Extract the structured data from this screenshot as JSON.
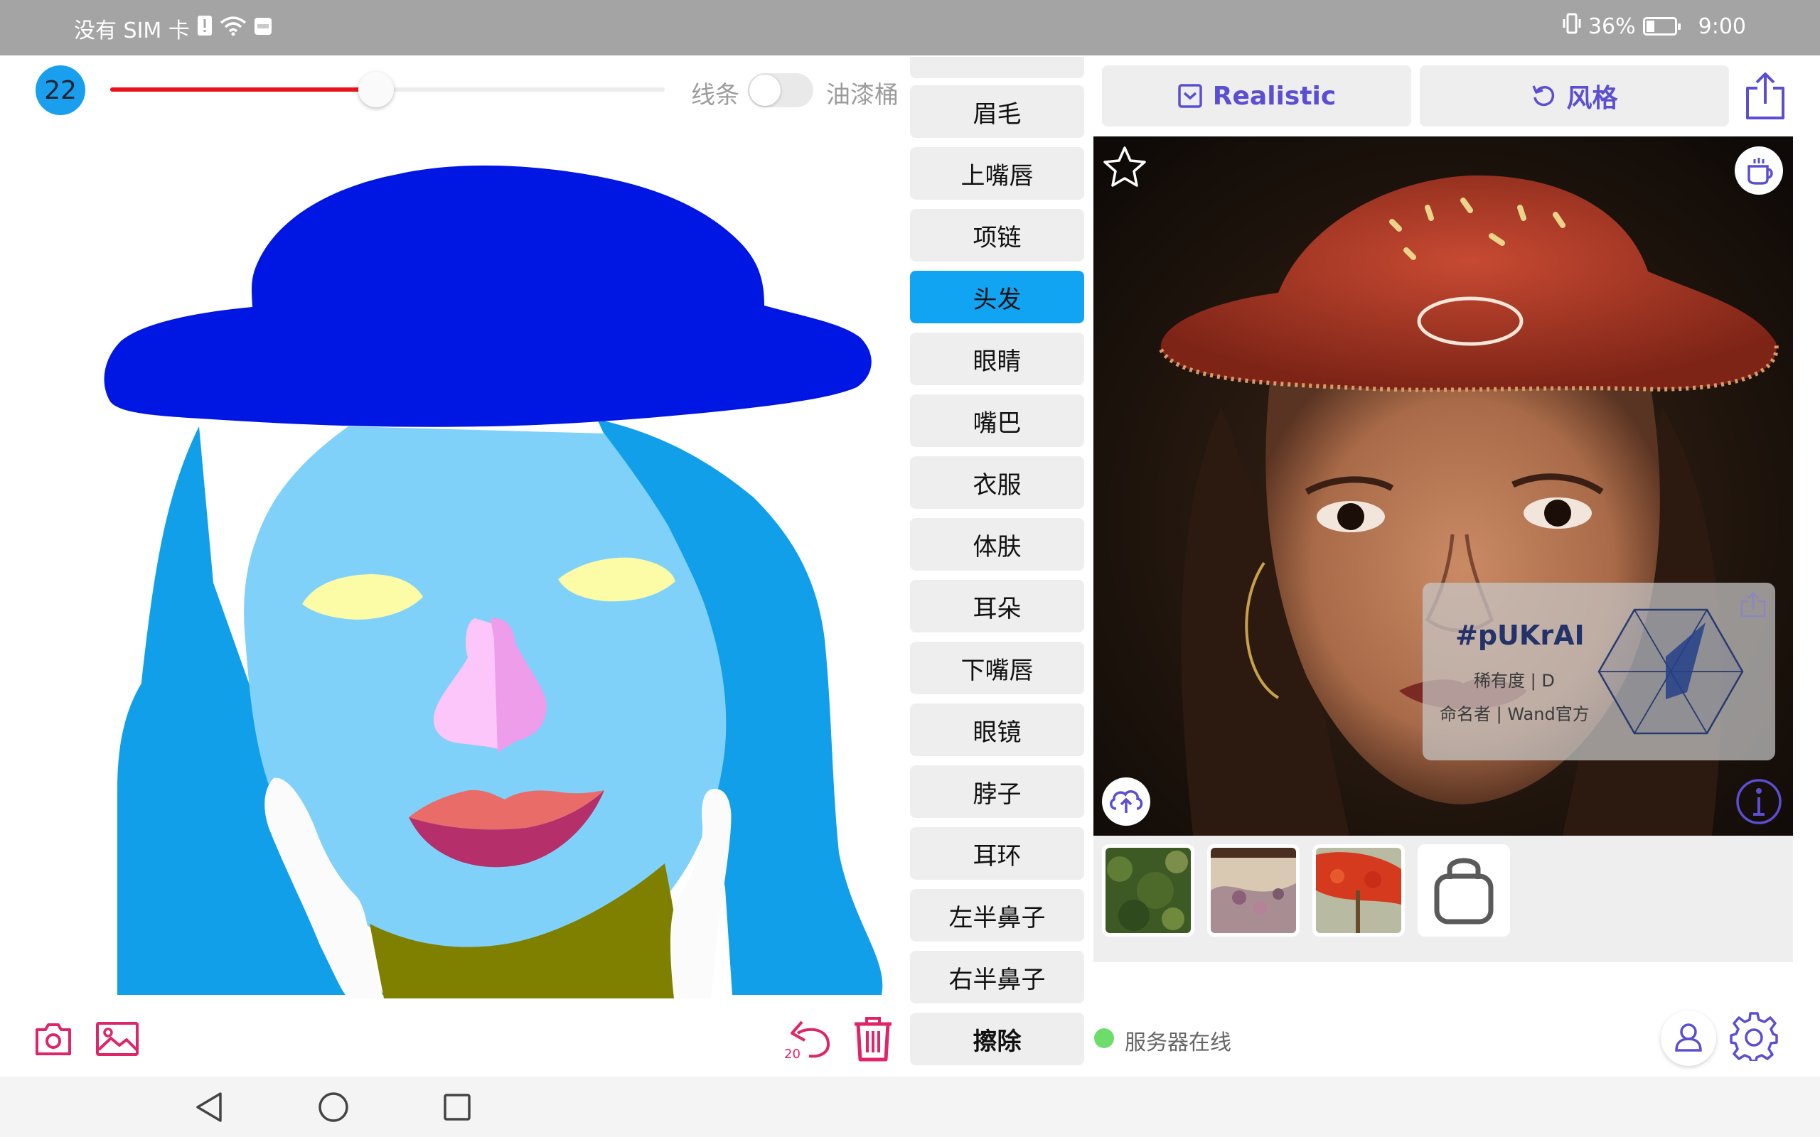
{
  "status_bar": {
    "carrier": "没有 SIM 卡",
    "battery": "36%",
    "battery_level": 0.36,
    "time": "9:00"
  },
  "brush": {
    "size": "22",
    "size_level": 0.48,
    "slider_color": "#e8131b"
  },
  "mode": {
    "line_label": "线条",
    "bucket_label": "油漆桶",
    "toggle_on": false
  },
  "labels": [
    {
      "label": "眉毛"
    },
    {
      "label": "上嘴唇"
    },
    {
      "label": "项链"
    },
    {
      "label": "头发",
      "active": true
    },
    {
      "label": "眼睛"
    },
    {
      "label": "嘴巴"
    },
    {
      "label": "衣服"
    },
    {
      "label": "体肤"
    },
    {
      "label": "耳朵"
    },
    {
      "label": "下嘴唇"
    },
    {
      "label": "眼镜"
    },
    {
      "label": "脖子"
    },
    {
      "label": "耳环"
    },
    {
      "label": "左半鼻子"
    },
    {
      "label": "右半鼻子"
    },
    {
      "label": "擦除",
      "bold": true
    }
  ],
  "top_buttons": {
    "realistic": "Realistic",
    "style": "风格"
  },
  "info_card": {
    "tag": "#pUKrAI",
    "rarity": "稀有度 | D",
    "namer": "命名者 | Wand官方"
  },
  "toolbar": {
    "undo_count": "20"
  },
  "server": {
    "status_text": "服务器在线",
    "status_color": "#6ddc6a"
  },
  "icons": [
    "camera-icon",
    "image-icon",
    "undo-icon",
    "trash-icon",
    "star-icon",
    "coffee-cup-icon",
    "cloud-upload-icon",
    "info-icon",
    "share-icon",
    "shopping-bag-icon",
    "user-icon",
    "gear-icon"
  ],
  "colors": {
    "accent": "#5b4ed2",
    "brush_badge": "#1a9fee",
    "active_label": "#11a4f2",
    "tool_pink": "#e0246a"
  }
}
